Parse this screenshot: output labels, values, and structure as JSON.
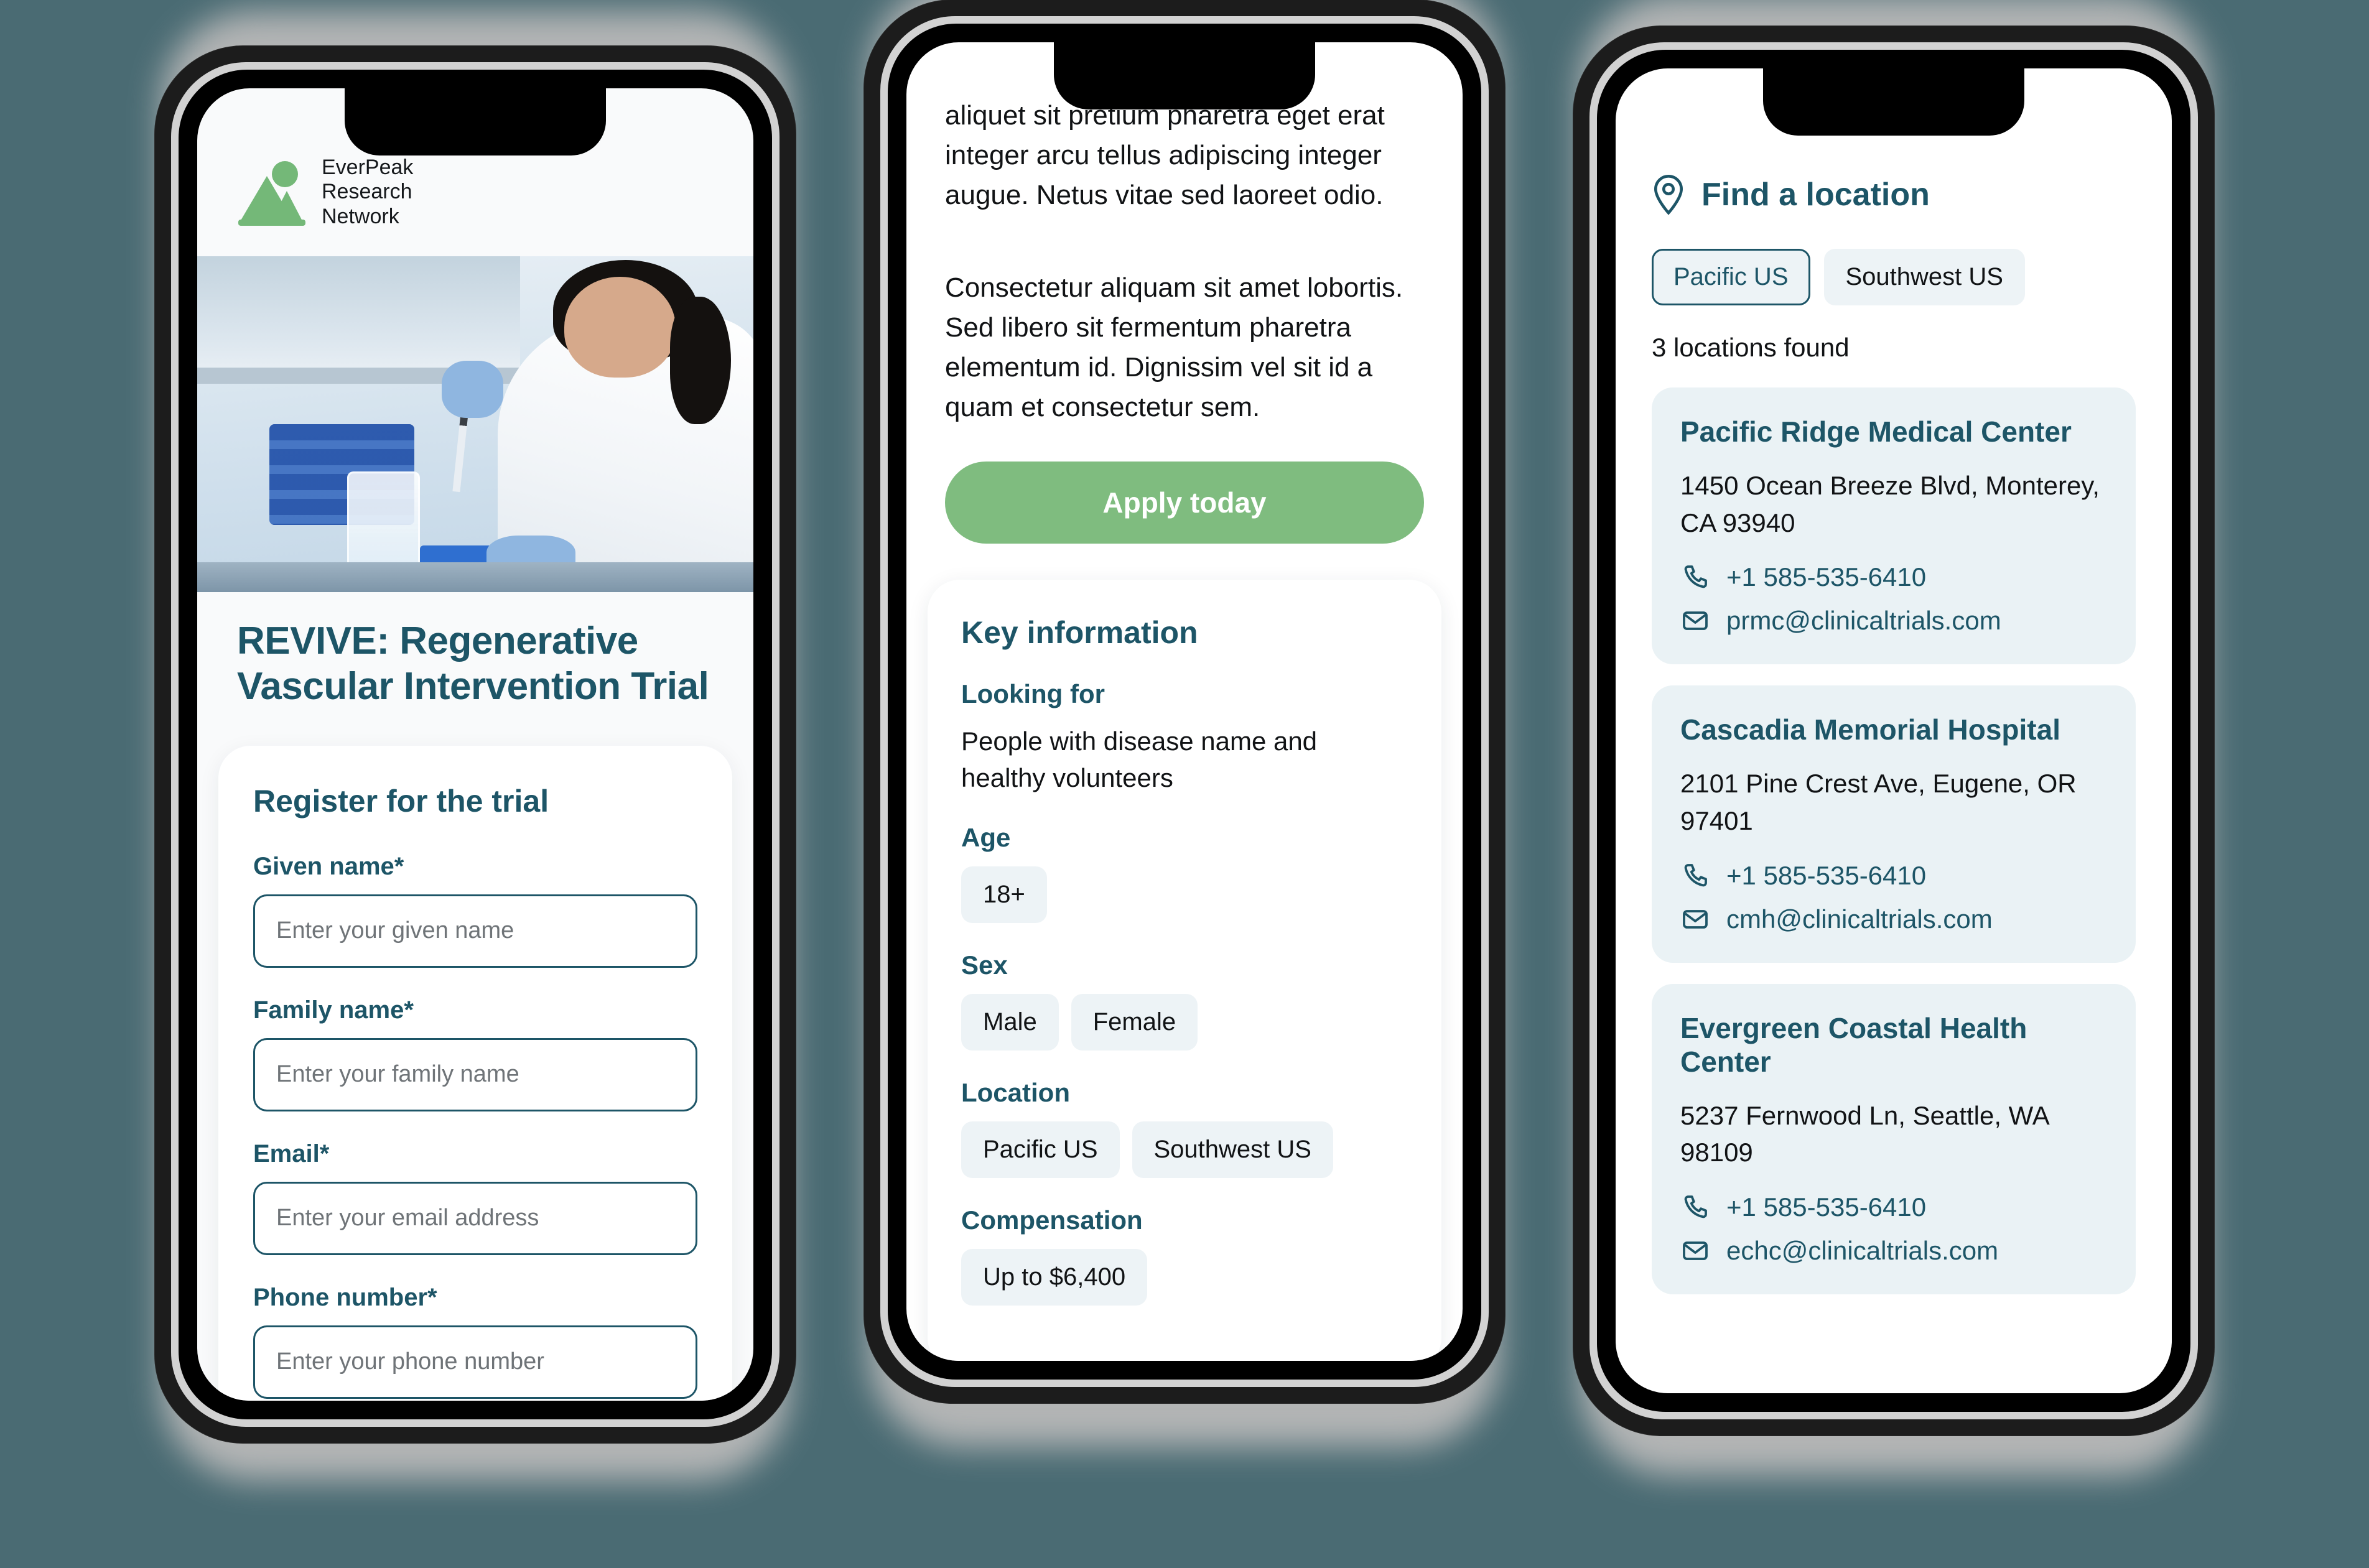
{
  "background_color": "#4a6b73",
  "brand": {
    "line1": "EverPeak",
    "line2": "Research",
    "line3": "Network",
    "logo_icon": "mountain-peak-logo",
    "logo_color": "#74b878"
  },
  "phone1": {
    "hero_image_alt": "lab-scientist-photo",
    "title": "REVIVE: Regenerative Vascular Intervention Trial",
    "register_card": {
      "heading": "Register for the trial",
      "fields": [
        {
          "label": "Given name*",
          "placeholder": "Enter your given name",
          "value": ""
        },
        {
          "label": "Family name*",
          "placeholder": "Enter your family name",
          "value": ""
        },
        {
          "label": "Email*",
          "placeholder": "Enter your email address",
          "value": ""
        },
        {
          "label": "Phone number*",
          "placeholder": "Enter your phone number",
          "value": ""
        }
      ]
    }
  },
  "phone2": {
    "paragraphs": [
      "aliquet sit pretium pharetra eget erat integer arcu tellus adipiscing integer augue. Netus vitae sed laoreet odio.",
      "Consectetur aliquam sit amet lobortis. Sed libero sit fermentum pharetra elementum id. Dignissim vel sit id a quam et consectetur sem."
    ],
    "apply_label": "Apply today",
    "apply_color": "#7fbc7f",
    "key_information": {
      "heading": "Key information",
      "groups": [
        {
          "label": "Looking for",
          "text": "People with disease name and healthy volunteers",
          "chips": []
        },
        {
          "label": "Age",
          "text": "",
          "chips": [
            "18+"
          ]
        },
        {
          "label": "Sex",
          "text": "",
          "chips": [
            "Male",
            "Female"
          ]
        },
        {
          "label": "Location",
          "text": "",
          "chips": [
            "Pacific US",
            "Southwest US"
          ]
        },
        {
          "label": "Compensation",
          "text": "",
          "chips": [
            "Up to $6,400"
          ]
        }
      ]
    }
  },
  "phone3": {
    "heading": "Find a location",
    "pin_icon": "map-pin-icon",
    "filters": [
      {
        "label": "Pacific US",
        "selected": true
      },
      {
        "label": "Southwest US",
        "selected": false
      }
    ],
    "results_text": "3 locations found",
    "locations": [
      {
        "name": "Pacific Ridge Medical Center",
        "address": "1450 Ocean Breeze Blvd, Monterey, CA 93940",
        "phone": "+1 585-535-6410",
        "email": "prmc@clinicaltrials.com"
      },
      {
        "name": "Cascadia Memorial Hospital",
        "address": "2101 Pine Crest Ave, Eugene, OR 97401",
        "phone": "+1 585-535-6410",
        "email": "cmh@clinicaltrials.com"
      },
      {
        "name": "Evergreen Coastal Health Center",
        "address": "5237 Fernwood Ln, Seattle, WA 98109",
        "phone": "+1 585-535-6410",
        "email": "echc@clinicaltrials.com"
      }
    ],
    "phone_icon": "phone-icon",
    "email_icon": "envelope-icon"
  }
}
